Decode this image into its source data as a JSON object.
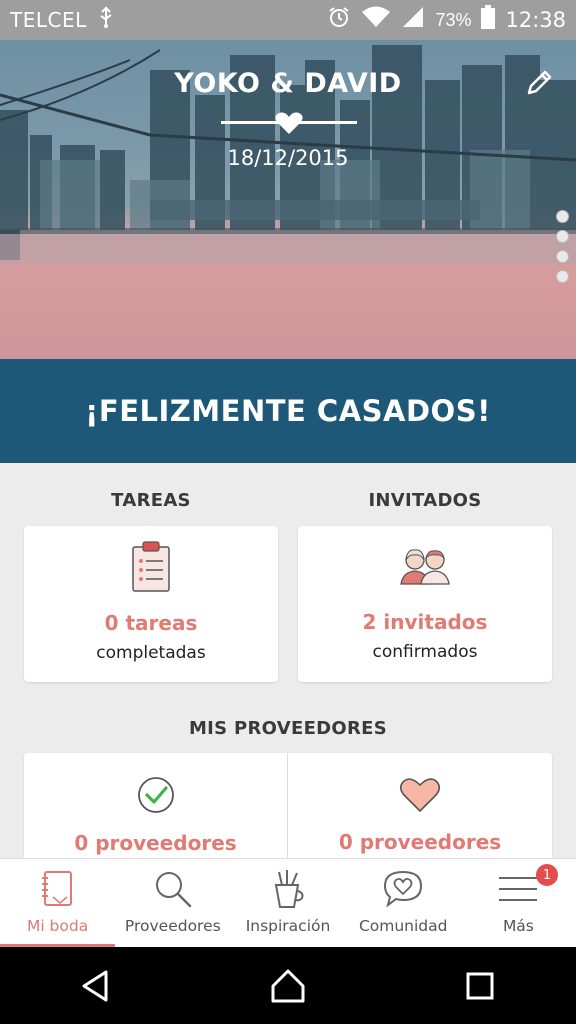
{
  "status_bar": {
    "carrier": "TELCEL",
    "battery_percent": "73%",
    "time": "12:38",
    "icons": [
      "usb-icon",
      "alarm-icon",
      "wifi-icon",
      "signal-icon",
      "battery-icon"
    ]
  },
  "hero": {
    "couple_names": "YOKO & DAVID",
    "wedding_date": "18/12/2015",
    "edit_icon": "pencil-icon",
    "carousel_dots": 4
  },
  "banner": {
    "text": "¡FELIZMENTE CASADOS!"
  },
  "tasks": {
    "title": "TAREAS",
    "count": "0 tareas",
    "sub": "completadas",
    "icon": "clipboard-icon"
  },
  "guests": {
    "title": "INVITADOS",
    "count": "2 invitados",
    "sub": "confirmados",
    "icon": "guests-icon"
  },
  "providers": {
    "title": "MIS PROVEEDORES",
    "left": {
      "count": "0 proveedores",
      "icon": "checkmark-circle-icon"
    },
    "right": {
      "count": "0 proveedores",
      "icon": "heart-icon"
    }
  },
  "bottom_nav": {
    "items": [
      {
        "label": "Mi boda",
        "icon": "notebook-icon",
        "active": true
      },
      {
        "label": "Proveedores",
        "icon": "search-icon"
      },
      {
        "label": "Inspiración",
        "icon": "pencil-cup-icon"
      },
      {
        "label": "Comunidad",
        "icon": "chat-heart-icon"
      },
      {
        "label": "Más",
        "icon": "menu-icon",
        "badge": "1"
      }
    ]
  },
  "colors": {
    "accent": "#e07a73",
    "banner": "#1e5878",
    "badge": "#e24d4d"
  }
}
